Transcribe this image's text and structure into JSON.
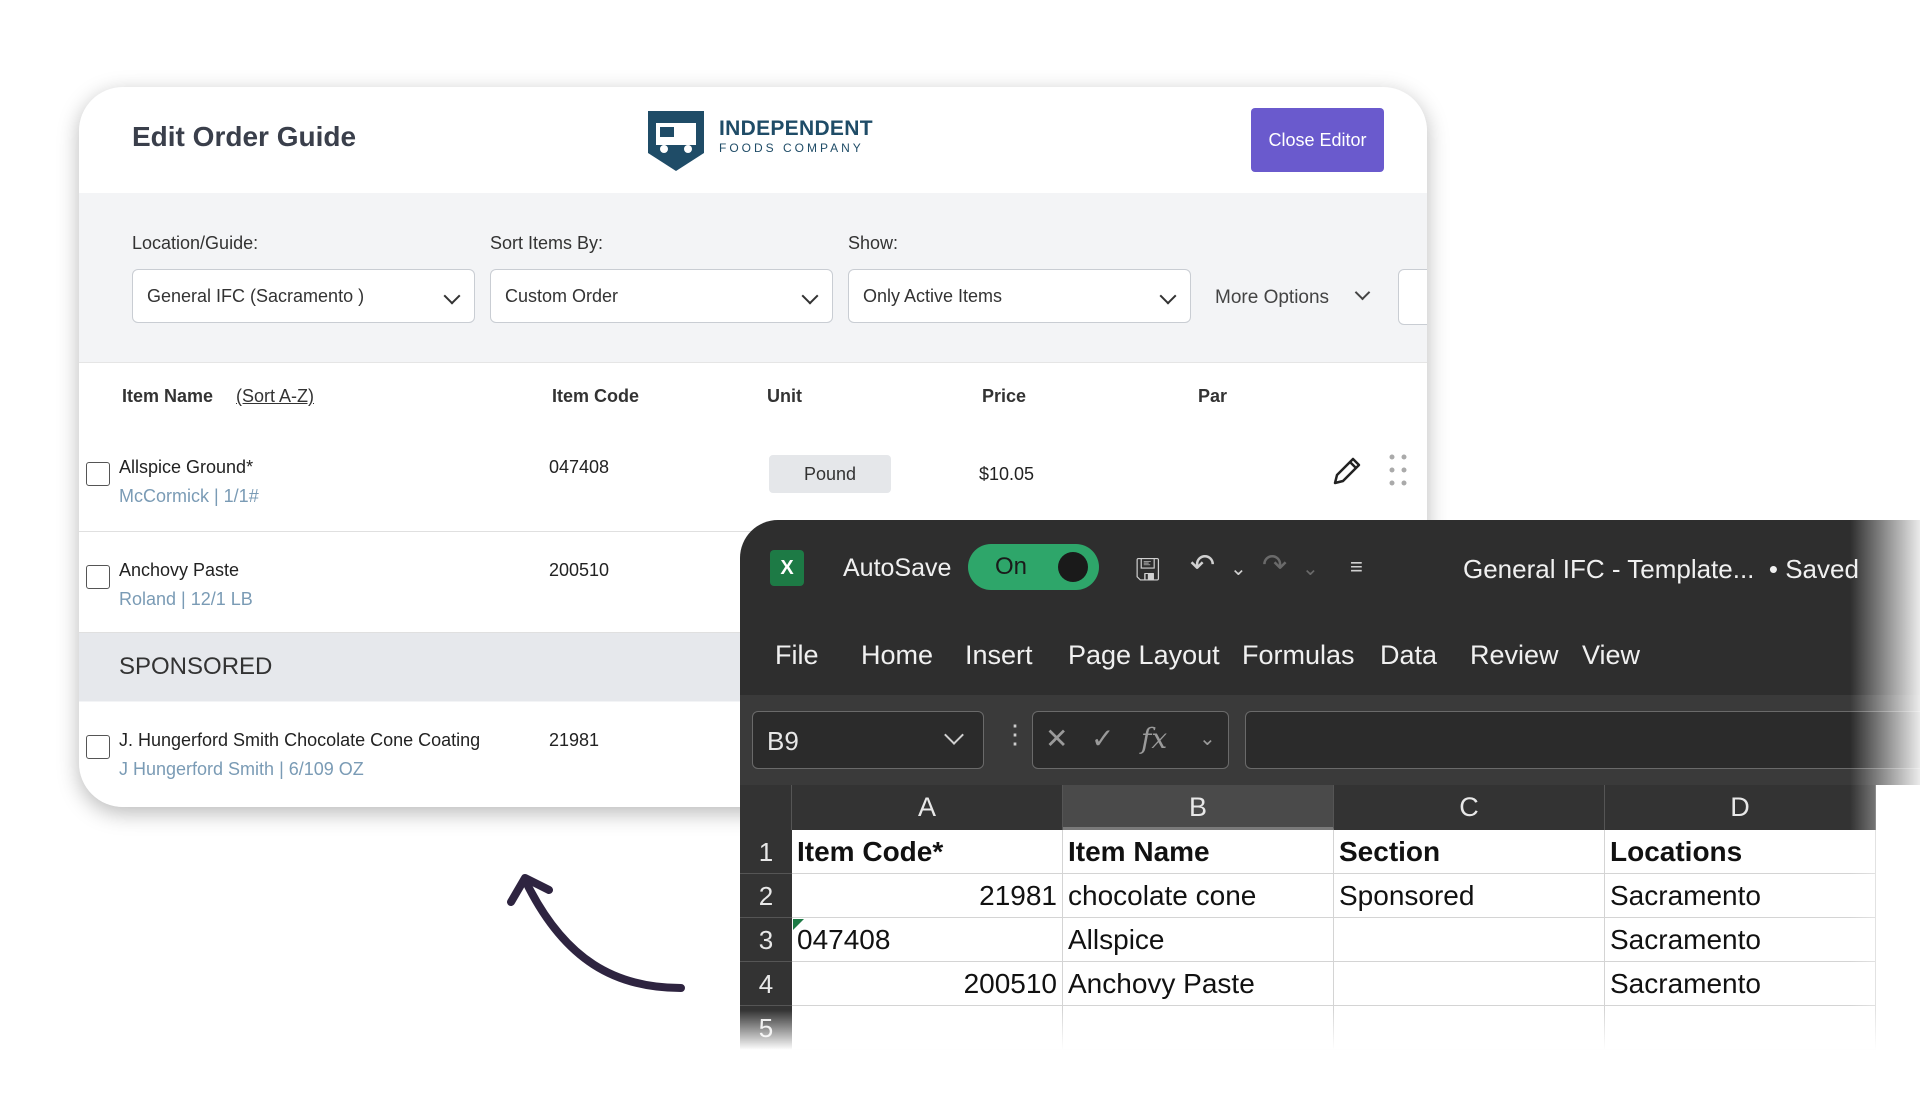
{
  "guide": {
    "title": "Edit Order Guide",
    "logo": {
      "line1": "INDEPENDENT",
      "line2": "FOODS COMPANY"
    },
    "close_label": "Close Editor",
    "filters": {
      "location_label": "Location/Guide:",
      "location_value": "General IFC (Sacramento )",
      "sort_label": "Sort Items By:",
      "sort_value": "Custom Order",
      "show_label": "Show:",
      "show_value": "Only Active Items",
      "more_options": "More Options"
    },
    "columns": {
      "item_name": "Item Name",
      "sort_link": "(Sort A-Z)",
      "item_code": "Item Code",
      "unit": "Unit",
      "price": "Price",
      "par": "Par"
    },
    "items": [
      {
        "name": "Allspice Ground*",
        "sub": "McCormick | 1/1#",
        "code": "047408",
        "unit": "Pound",
        "price": "$10.05"
      },
      {
        "name": "Anchovy Paste",
        "sub": "Roland | 12/1 LB",
        "code": "200510"
      }
    ],
    "section_label": "SPONSORED",
    "sponsored_items": [
      {
        "name": "J. Hungerford Smith Chocolate Cone Coating",
        "sub": "J Hungerford Smith | 6/109 OZ",
        "code": "21981"
      }
    ]
  },
  "excel": {
    "autosave_label": "AutoSave",
    "toggle_label": "On",
    "doc_title": "General IFC - Template...",
    "doc_status": "• Saved",
    "menu": [
      "File",
      "Home",
      "Insert",
      "Page Layout",
      "Formulas",
      "Data",
      "Review",
      "View"
    ],
    "name_box": "B9",
    "fx_label": "fx",
    "column_headers": [
      "A",
      "B",
      "C",
      "D"
    ],
    "row_headers": [
      "1",
      "2",
      "3",
      "4",
      "5"
    ],
    "rows": [
      [
        "Item Code*",
        "Item Name",
        "Section",
        "Locations"
      ],
      [
        "21981",
        "chocolate cone",
        "Sponsored",
        "Sacramento"
      ],
      [
        "047408",
        "Allspice",
        "",
        "Sacramento"
      ],
      [
        "200510",
        "Anchovy Paste",
        "",
        "Sacramento"
      ]
    ],
    "colors": {
      "toggle": "#2ea66a",
      "ribbon": "#2e2e2e",
      "brand_button": "#6a5acd"
    }
  }
}
